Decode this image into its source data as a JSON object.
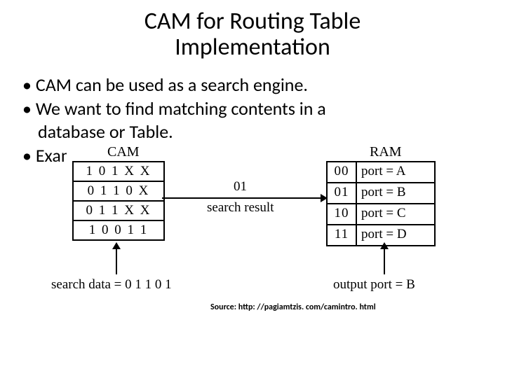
{
  "title_l1": "CAM for Routing Table",
  "title_l2": "Implementation",
  "bullets": {
    "b1": "CAM can be used as a search engine.",
    "b2a": "We want to find matching contents in a",
    "b2b": "database or Table.",
    "b3": "Exam"
  },
  "diagram": {
    "cam_header": "CAM",
    "ram_header": "RAM",
    "cam_rows": [
      "1 0 1 X X",
      "0 1 1 0 X",
      "0 1 1 X X",
      "1 0 0 1 1"
    ],
    "ram_rows": [
      {
        "addr": "00",
        "val": "port = A"
      },
      {
        "addr": "01",
        "val": "port = B"
      },
      {
        "addr": "10",
        "val": "port = C"
      },
      {
        "addr": "11",
        "val": "port = D"
      }
    ],
    "search_result_num": "01",
    "search_result_label": "search result",
    "search_data_label": "search data = 0 1 1 0 1",
    "output_port_label": "output port = B"
  },
  "source": "Source: http: //pagiamtzis. com/camintro. html"
}
